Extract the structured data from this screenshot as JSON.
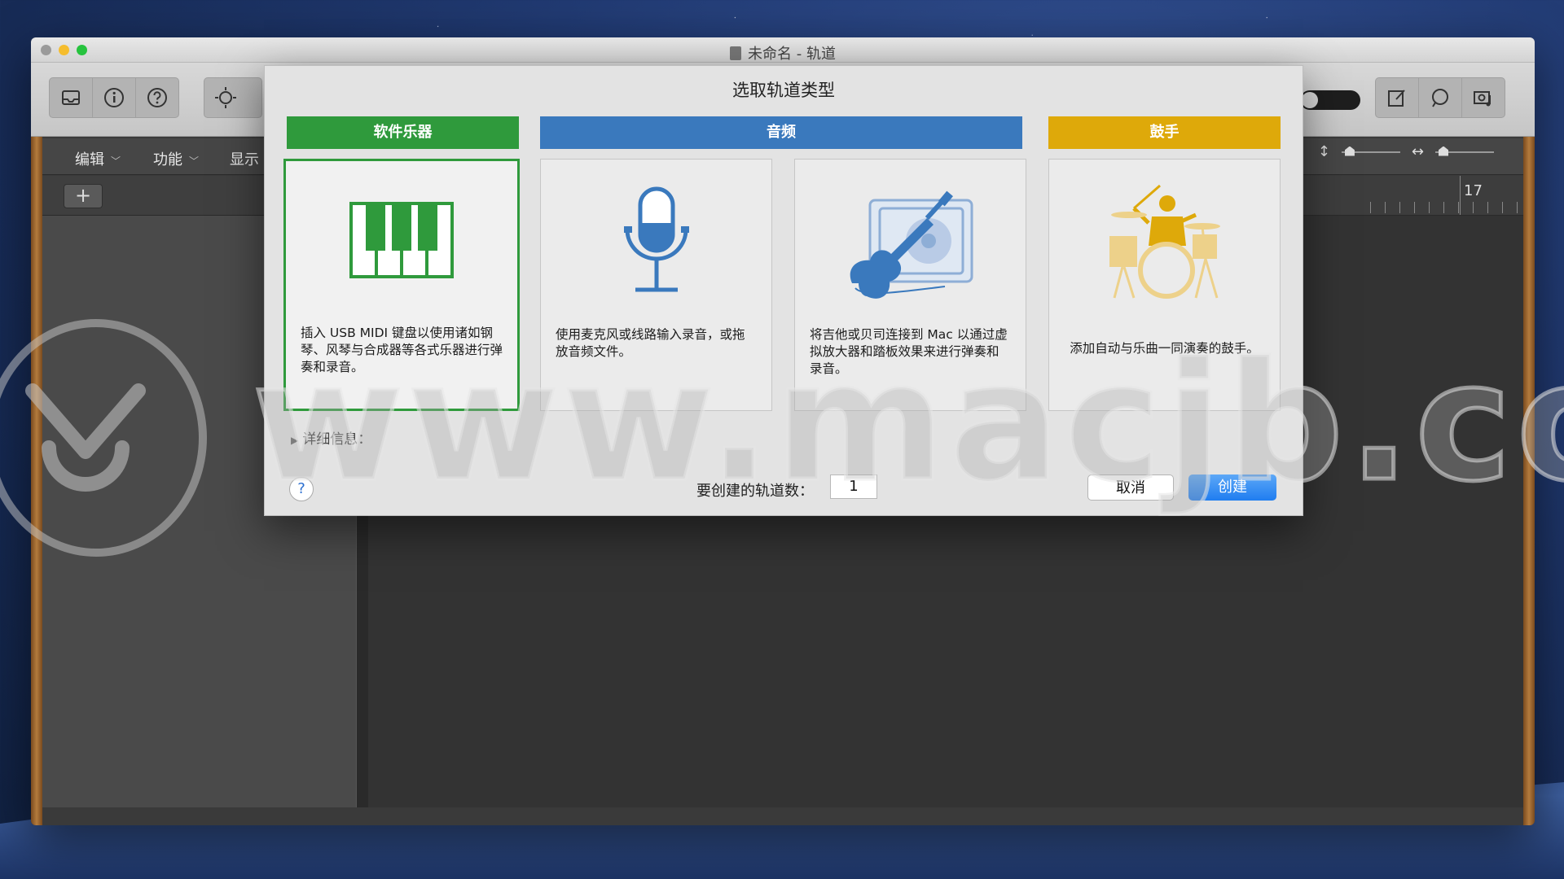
{
  "window": {
    "title": "未命名 - 轨道"
  },
  "menubar": {
    "items": [
      "编辑",
      "功能",
      "显示"
    ]
  },
  "ruler": {
    "bar_number": "17"
  },
  "dialog": {
    "title": "选取轨道类型",
    "categories": {
      "software": "软件乐器",
      "audio": "音频",
      "drummer": "鼓手"
    },
    "cards": {
      "software": "插入 USB MIDI 键盘以使用诸如钢琴、风琴与合成器等各式乐器进行弹奏和录音。",
      "microphone": "使用麦克风或线路输入录音，或拖放音频文件。",
      "guitar": "将吉他或贝司连接到 Mac 以通过虚拟放大器和踏板效果来进行弹奏和录音。",
      "drummer": "添加自动与乐曲一同演奏的鼓手。"
    },
    "details_label": "详细信息：",
    "help_symbol": "?",
    "count_label": "要创建的轨道数：",
    "count_value": "1",
    "cancel_label": "取消",
    "create_label": "创建"
  },
  "watermark": {
    "text": "www.macjb.com"
  },
  "colors": {
    "software": "#2f9a3c",
    "audio": "#3a79bd",
    "drummer": "#dea90a",
    "create_button": "#1f7df0"
  },
  "icons": [
    "library-icon",
    "info-icon",
    "help-icon",
    "brightness-icon",
    "notepad-icon",
    "loop-browser-icon",
    "media-browser-icon",
    "piano-keyboard-icon",
    "microphone-icon",
    "guitar-icon",
    "drummer-icon"
  ]
}
